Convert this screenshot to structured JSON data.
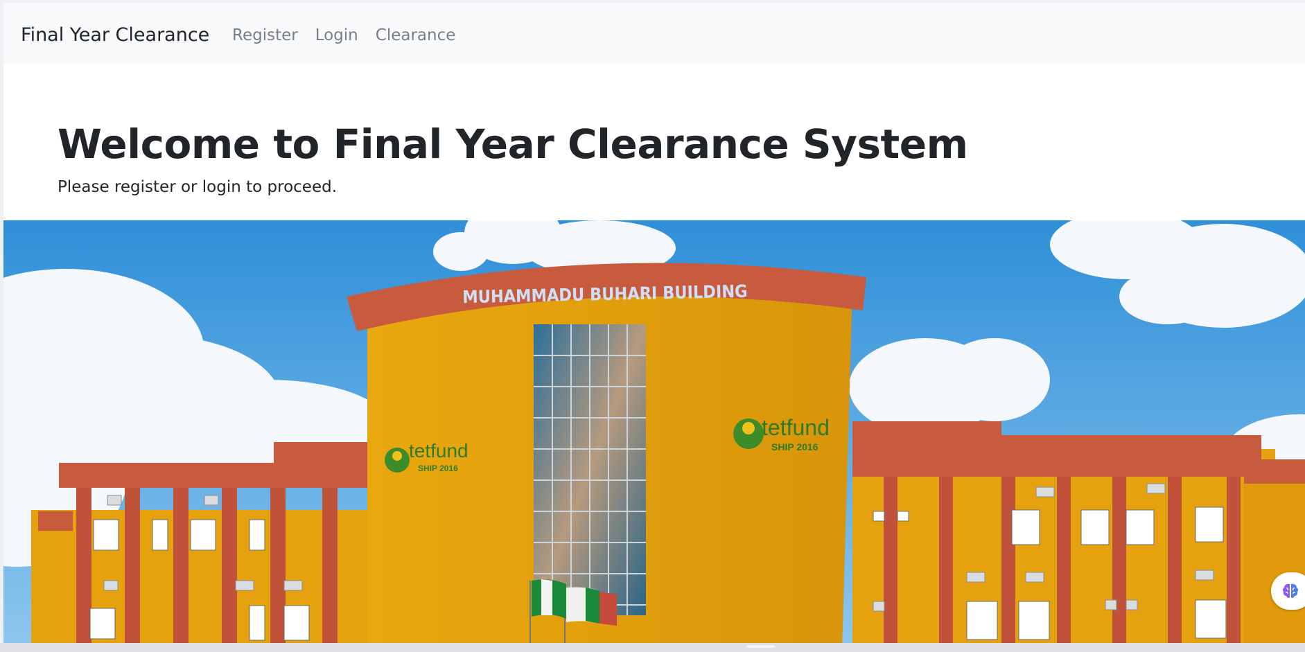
{
  "navbar": {
    "brand": "Final Year Clearance",
    "links": [
      {
        "label": "Register"
      },
      {
        "label": "Login"
      },
      {
        "label": "Clearance"
      }
    ]
  },
  "hero": {
    "heading": "Welcome to Final Year Clearance System",
    "subtext": "Please register or login to proceed."
  },
  "banner": {
    "building_sign": "MUHAMMADU BUHARI BUILDING",
    "logo_left": {
      "name": "tetfund",
      "tag": "SHIP 2016"
    },
    "logo_right": {
      "name": "tetfund",
      "tag": "SHIP 2016"
    }
  },
  "colors": {
    "navbar_bg": "#f8f9fa",
    "nav_link": "#7a7f85",
    "text": "#212529",
    "sky": "#3f9fe0",
    "building": "#e4a10f",
    "roof": "#c0533e"
  },
  "floating_button": {
    "icon": "brain-icon"
  }
}
